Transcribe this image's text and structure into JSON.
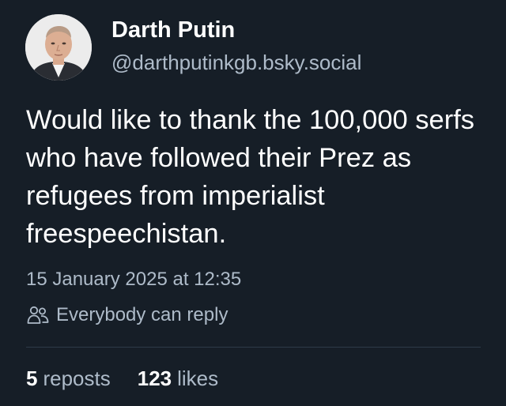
{
  "author": {
    "display_name": "Darth Putin",
    "handle": "@darthputinkgb.bsky.social",
    "avatar_icon": "profile-photo"
  },
  "post": {
    "text": "Would like to thank the 100,000 serfs who have followed their Prez as refugees from imperialist freespeechistan.",
    "timestamp": "15 January 2025 at 12:35",
    "reply_setting": "Everybody can reply",
    "reply_icon": "people-icon"
  },
  "stats": {
    "reposts_count": "5",
    "reposts_label": "reposts",
    "likes_count": "123",
    "likes_label": "likes"
  },
  "colors": {
    "background": "#161e27",
    "primary_text": "#ffffff",
    "secondary_text": "#aebbc9",
    "divider": "#2e3a48"
  }
}
